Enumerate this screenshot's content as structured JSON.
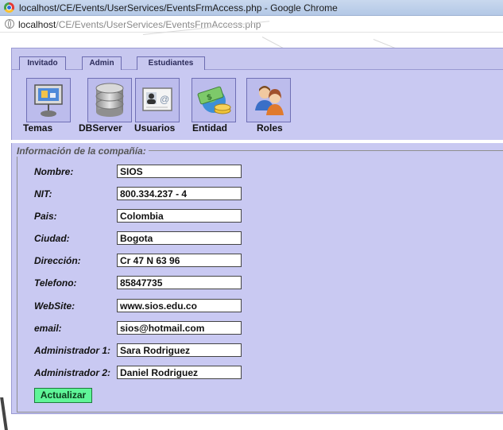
{
  "window": {
    "title": "localhost/CE/Events/UserServices/EventsFrmAccess.php - Google Chrome"
  },
  "address": {
    "host": "localhost",
    "path": "/CE/Events/UserServices/EventsFrmAccess.php"
  },
  "tabs": [
    {
      "label": "Invitado"
    },
    {
      "label": "Admin"
    },
    {
      "label": "Estudiantes"
    }
  ],
  "toolbar": {
    "items": [
      {
        "label": "Temas",
        "icon": "presentation-board-icon"
      },
      {
        "label": "DBServer",
        "icon": "database-icon"
      },
      {
        "label": "Usuarios",
        "icon": "contact-card-icon"
      },
      {
        "label": "Entidad",
        "icon": "money-globe-icon"
      },
      {
        "label": "Roles",
        "icon": "users-icon"
      }
    ]
  },
  "form": {
    "legend": "Información de la compañía:",
    "fields": [
      {
        "label": "Nombre:",
        "value": "SIOS"
      },
      {
        "label": "NIT:",
        "value": "800.334.237 - 4"
      },
      {
        "label": "Pais:",
        "value": "Colombia"
      },
      {
        "label": "Ciudad:",
        "value": "Bogota"
      },
      {
        "label": "Dirección:",
        "value": "Cr 47 N 63 96"
      },
      {
        "label": "Telefono:",
        "value": "85847735"
      },
      {
        "label": "WebSite:",
        "value": "www.sios.edu.co"
      },
      {
        "label": "email:",
        "value": "sios@hotmail.com"
      },
      {
        "label": "Administrador 1:",
        "value": "Sara Rodriguez"
      },
      {
        "label": "Administrador 2:",
        "value": "Daniel Rodriguez"
      }
    ],
    "submit_label": "Actualizar"
  },
  "colors": {
    "panel": "#c9c9f2",
    "button": "#5ff598"
  }
}
